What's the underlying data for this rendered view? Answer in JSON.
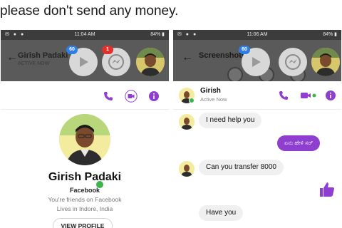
{
  "caption": "please don't send any money.",
  "left": {
    "status": {
      "icons": "✉ ● ●",
      "time": "11:04 AM",
      "battery": "84% ▮"
    },
    "header": {
      "title": "Girish Padaki",
      "subtitle": "ACTIVE NOW"
    },
    "chatheads": {
      "play_badge": "60",
      "messenger_badge": "1"
    },
    "profile": {
      "name": "Girish Padaki",
      "source": "Facebook",
      "friends": "You're friends on Facebook",
      "location": "Lives in Indore, India",
      "view_profile": "VIEW PROFILE"
    },
    "icons": [
      "phone-icon",
      "video-icon",
      "info-icon"
    ]
  },
  "right": {
    "status": {
      "icons": "✉ ● ●",
      "time": "11:06 AM",
      "battery": "84% ▮"
    },
    "header": {
      "title": "Screenshots",
      "back": "←"
    },
    "chatheads": {
      "play_badge": "60"
    },
    "chat": {
      "name": "Girish",
      "status": "Active Now"
    },
    "messages": [
      {
        "from": "them",
        "text": "I need help you"
      },
      {
        "from": "me",
        "text": "ಏನು ಹೇಳಿ ಸರ್"
      },
      {
        "from": "them",
        "text": "Can you transfer 8000"
      },
      {
        "from": "me",
        "text": "thumbs-up"
      },
      {
        "from": "them",
        "text": "Have you"
      }
    ],
    "accent_color": "#8e3fd0",
    "icons": [
      "phone-icon",
      "video-icon",
      "info-icon"
    ]
  }
}
